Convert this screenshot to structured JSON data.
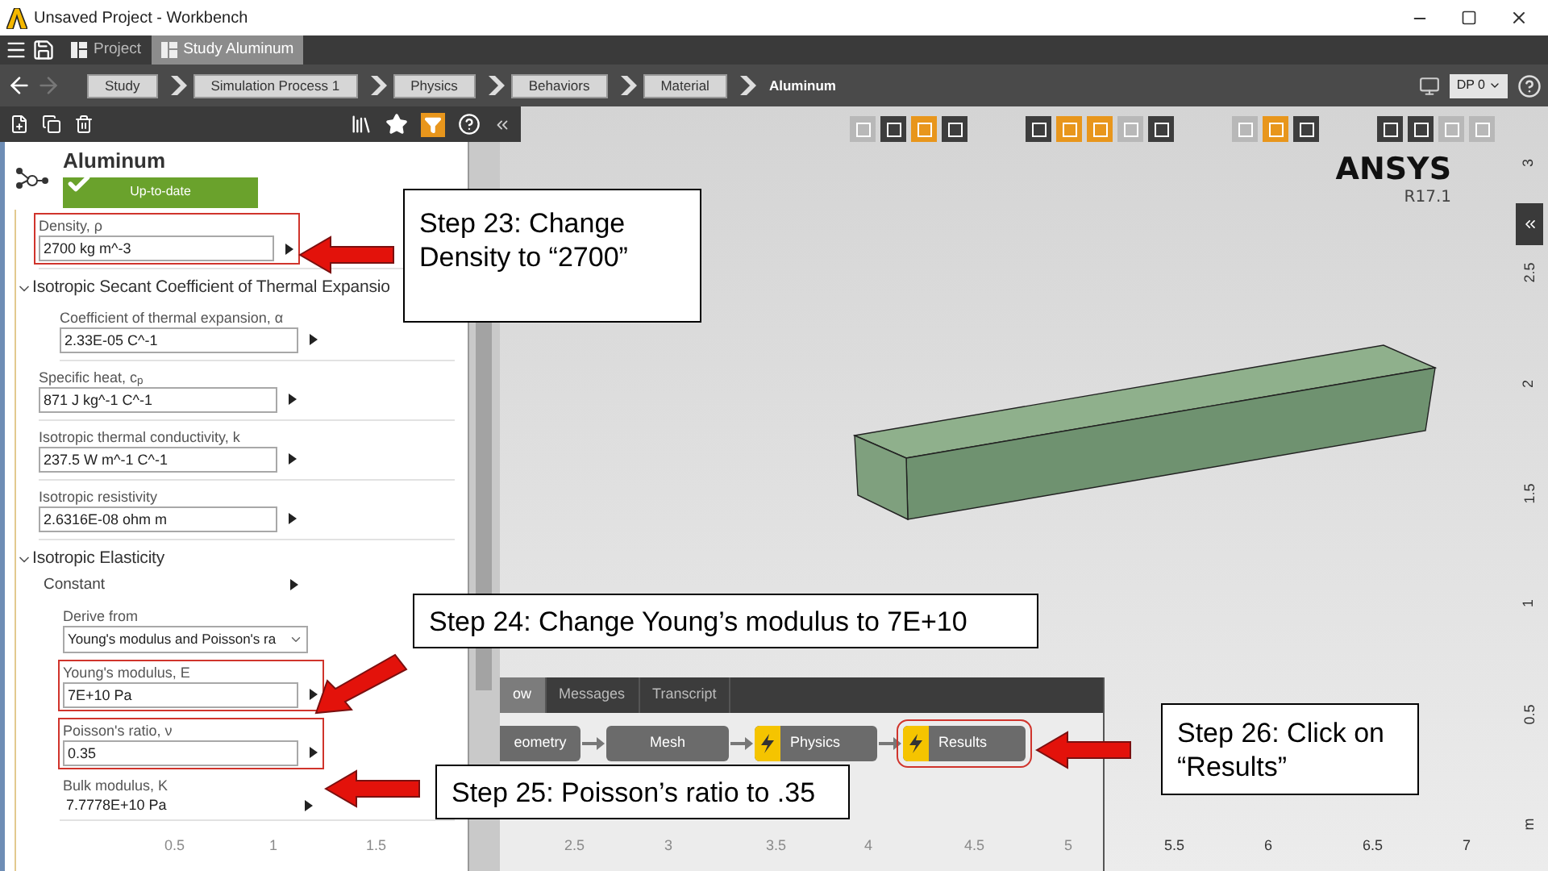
{
  "window": {
    "title": "Unsaved Project - Workbench"
  },
  "tabs": [
    {
      "label": "Project",
      "selected": false
    },
    {
      "label": "Study Aluminum",
      "selected": true
    }
  ],
  "breadcrumbs": [
    {
      "label": "Study",
      "kind": "button"
    },
    {
      "label": "Simulation Process 1",
      "kind": "button"
    },
    {
      "label": "Physics",
      "kind": "button"
    },
    {
      "label": "Behaviors",
      "kind": "button"
    },
    {
      "label": "Material",
      "kind": "button"
    },
    {
      "label": "Aluminum",
      "kind": "current"
    }
  ],
  "design_point": {
    "label": "DP 0"
  },
  "panel": {
    "title": "Aluminum",
    "status": "Up-to-date",
    "rows": [
      {
        "kind": "field",
        "label": "Density, ρ",
        "value": "2700 kg m^-3",
        "highlighted": true
      },
      {
        "kind": "section",
        "label": "Isotropic Secant Coefficient of Thermal Expansio",
        "expanded": true,
        "children": [
          {
            "kind": "field",
            "label": "Coefficient of thermal expansion, α",
            "value": "2.33E-05 C^-1",
            "highlighted": false
          }
        ]
      },
      {
        "kind": "field",
        "label": "Specific heat, c$_{p}$",
        "value": "871 J kg^-1 C^-1",
        "highlighted": false
      },
      {
        "kind": "field",
        "label": "Isotropic thermal conductivity, k",
        "value": "237.5 W m^-1 C^-1",
        "highlighted": false
      },
      {
        "kind": "field",
        "label": "Isotropic resistivity",
        "value": "2.6316E-08 ohm m",
        "highlighted": false
      },
      {
        "kind": "section",
        "label": "Isotropic Elasticity",
        "expanded": true,
        "children": [
          {
            "kind": "option",
            "label": "Constant",
            "children": [
              {
                "kind": "dropdown",
                "label": "Derive from",
                "value": "Young's modulus and Poisson's ra"
              },
              {
                "kind": "field",
                "label": "Young's modulus, E",
                "value": "7E+10 Pa",
                "highlighted": true
              },
              {
                "kind": "field",
                "label": "Poisson's ratio, ν",
                "value": "0.35",
                "highlighted": true
              },
              {
                "kind": "readout",
                "label": "Bulk modulus, K",
                "value": "7.7778E+10 Pa"
              }
            ]
          }
        ]
      }
    ]
  },
  "viewport": {
    "logo": "ANSYS",
    "version": "R17.1",
    "y_ticks": [
      "3",
      "2.5",
      "2",
      "1.5",
      "1",
      "0.5",
      "m"
    ],
    "x_ticks": [
      {
        "label": "0.5",
        "faint": true
      },
      {
        "label": "1",
        "faint": true
      },
      {
        "label": "1.5",
        "faint": true
      },
      {
        "label": "2.5",
        "faint": true
      },
      {
        "label": "3",
        "faint": true
      },
      {
        "label": "3.5",
        "faint": true
      },
      {
        "label": "4",
        "faint": true
      },
      {
        "label": "4.5",
        "faint": true
      },
      {
        "label": "5",
        "faint": true
      },
      {
        "label": "5.5",
        "faint": false
      },
      {
        "label": "6",
        "faint": false
      },
      {
        "label": "6.5",
        "faint": false
      },
      {
        "label": "7",
        "faint": false
      }
    ]
  },
  "workflow": {
    "tabs": [
      {
        "label": "ow",
        "selected": true
      },
      {
        "label": "Messages",
        "selected": false
      },
      {
        "label": "Transcript",
        "selected": false
      }
    ],
    "nodes": [
      {
        "label": "eometry",
        "lightning": false,
        "highlighted": false
      },
      {
        "label": "Mesh",
        "lightning": false,
        "highlighted": false
      },
      {
        "label": "Physics",
        "lightning": true,
        "highlighted": false
      },
      {
        "label": "Results",
        "lightning": true,
        "highlighted": true
      }
    ]
  },
  "callouts": [
    {
      "text": "Step 23: Change Density to “2700”"
    },
    {
      "text": "Step 24: Change Young’s modulus to 7E+10"
    },
    {
      "text": "Step 25: Poisson’s ratio to .35"
    },
    {
      "text": "Step 26: Click on “Results”"
    }
  ]
}
